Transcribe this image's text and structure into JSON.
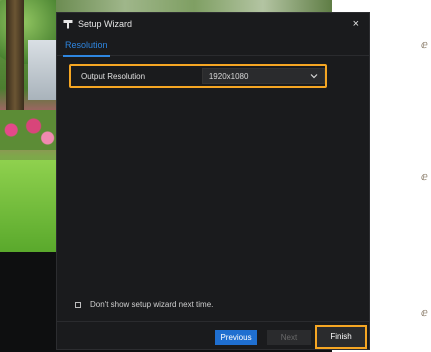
{
  "dialog": {
    "title": "Setup Wizard",
    "close_glyph": "×",
    "tab": "Resolution",
    "setting": {
      "label": "Output Resolution",
      "value": "1920x1080"
    },
    "dont_show_label": "Don't show setup wizard next time.",
    "buttons": {
      "previous": "Previous",
      "next": "Next",
      "finish": "Finish"
    }
  },
  "colors": {
    "accent": "#2e86e0",
    "highlight": "#f5a623",
    "primary_button": "#1f6fd0",
    "dialog_bg": "#1a1b1d"
  },
  "icons": [
    "wizard-icon",
    "close-icon",
    "chevron-down-icon",
    "checkbox-icon"
  ]
}
